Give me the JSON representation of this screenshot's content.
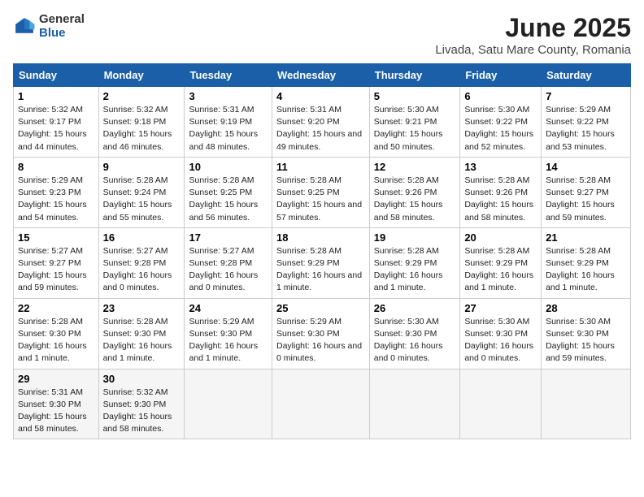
{
  "logo": {
    "general": "General",
    "blue": "Blue"
  },
  "title": "June 2025",
  "subtitle": "Livada, Satu Mare County, Romania",
  "headers": [
    "Sunday",
    "Monday",
    "Tuesday",
    "Wednesday",
    "Thursday",
    "Friday",
    "Saturday"
  ],
  "weeks": [
    [
      {
        "day": "1",
        "sunrise": "Sunrise: 5:32 AM",
        "sunset": "Sunset: 9:17 PM",
        "daylight": "Daylight: 15 hours and 44 minutes."
      },
      {
        "day": "2",
        "sunrise": "Sunrise: 5:32 AM",
        "sunset": "Sunset: 9:18 PM",
        "daylight": "Daylight: 15 hours and 46 minutes."
      },
      {
        "day": "3",
        "sunrise": "Sunrise: 5:31 AM",
        "sunset": "Sunset: 9:19 PM",
        "daylight": "Daylight: 15 hours and 48 minutes."
      },
      {
        "day": "4",
        "sunrise": "Sunrise: 5:31 AM",
        "sunset": "Sunset: 9:20 PM",
        "daylight": "Daylight: 15 hours and 49 minutes."
      },
      {
        "day": "5",
        "sunrise": "Sunrise: 5:30 AM",
        "sunset": "Sunset: 9:21 PM",
        "daylight": "Daylight: 15 hours and 50 minutes."
      },
      {
        "day": "6",
        "sunrise": "Sunrise: 5:30 AM",
        "sunset": "Sunset: 9:22 PM",
        "daylight": "Daylight: 15 hours and 52 minutes."
      },
      {
        "day": "7",
        "sunrise": "Sunrise: 5:29 AM",
        "sunset": "Sunset: 9:22 PM",
        "daylight": "Daylight: 15 hours and 53 minutes."
      }
    ],
    [
      {
        "day": "8",
        "sunrise": "Sunrise: 5:29 AM",
        "sunset": "Sunset: 9:23 PM",
        "daylight": "Daylight: 15 hours and 54 minutes."
      },
      {
        "day": "9",
        "sunrise": "Sunrise: 5:28 AM",
        "sunset": "Sunset: 9:24 PM",
        "daylight": "Daylight: 15 hours and 55 minutes."
      },
      {
        "day": "10",
        "sunrise": "Sunrise: 5:28 AM",
        "sunset": "Sunset: 9:25 PM",
        "daylight": "Daylight: 15 hours and 56 minutes."
      },
      {
        "day": "11",
        "sunrise": "Sunrise: 5:28 AM",
        "sunset": "Sunset: 9:25 PM",
        "daylight": "Daylight: 15 hours and 57 minutes."
      },
      {
        "day": "12",
        "sunrise": "Sunrise: 5:28 AM",
        "sunset": "Sunset: 9:26 PM",
        "daylight": "Daylight: 15 hours and 58 minutes."
      },
      {
        "day": "13",
        "sunrise": "Sunrise: 5:28 AM",
        "sunset": "Sunset: 9:26 PM",
        "daylight": "Daylight: 15 hours and 58 minutes."
      },
      {
        "day": "14",
        "sunrise": "Sunrise: 5:28 AM",
        "sunset": "Sunset: 9:27 PM",
        "daylight": "Daylight: 15 hours and 59 minutes."
      }
    ],
    [
      {
        "day": "15",
        "sunrise": "Sunrise: 5:27 AM",
        "sunset": "Sunset: 9:27 PM",
        "daylight": "Daylight: 15 hours and 59 minutes."
      },
      {
        "day": "16",
        "sunrise": "Sunrise: 5:27 AM",
        "sunset": "Sunset: 9:28 PM",
        "daylight": "Daylight: 16 hours and 0 minutes."
      },
      {
        "day": "17",
        "sunrise": "Sunrise: 5:27 AM",
        "sunset": "Sunset: 9:28 PM",
        "daylight": "Daylight: 16 hours and 0 minutes."
      },
      {
        "day": "18",
        "sunrise": "Sunrise: 5:28 AM",
        "sunset": "Sunset: 9:29 PM",
        "daylight": "Daylight: 16 hours and 1 minute."
      },
      {
        "day": "19",
        "sunrise": "Sunrise: 5:28 AM",
        "sunset": "Sunset: 9:29 PM",
        "daylight": "Daylight: 16 hours and 1 minute."
      },
      {
        "day": "20",
        "sunrise": "Sunrise: 5:28 AM",
        "sunset": "Sunset: 9:29 PM",
        "daylight": "Daylight: 16 hours and 1 minute."
      },
      {
        "day": "21",
        "sunrise": "Sunrise: 5:28 AM",
        "sunset": "Sunset: 9:29 PM",
        "daylight": "Daylight: 16 hours and 1 minute."
      }
    ],
    [
      {
        "day": "22",
        "sunrise": "Sunrise: 5:28 AM",
        "sunset": "Sunset: 9:30 PM",
        "daylight": "Daylight: 16 hours and 1 minute."
      },
      {
        "day": "23",
        "sunrise": "Sunrise: 5:28 AM",
        "sunset": "Sunset: 9:30 PM",
        "daylight": "Daylight: 16 hours and 1 minute."
      },
      {
        "day": "24",
        "sunrise": "Sunrise: 5:29 AM",
        "sunset": "Sunset: 9:30 PM",
        "daylight": "Daylight: 16 hours and 1 minute."
      },
      {
        "day": "25",
        "sunrise": "Sunrise: 5:29 AM",
        "sunset": "Sunset: 9:30 PM",
        "daylight": "Daylight: 16 hours and 0 minutes."
      },
      {
        "day": "26",
        "sunrise": "Sunrise: 5:30 AM",
        "sunset": "Sunset: 9:30 PM",
        "daylight": "Daylight: 16 hours and 0 minutes."
      },
      {
        "day": "27",
        "sunrise": "Sunrise: 5:30 AM",
        "sunset": "Sunset: 9:30 PM",
        "daylight": "Daylight: 16 hours and 0 minutes."
      },
      {
        "day": "28",
        "sunrise": "Sunrise: 5:30 AM",
        "sunset": "Sunset: 9:30 PM",
        "daylight": "Daylight: 15 hours and 59 minutes."
      }
    ],
    [
      {
        "day": "29",
        "sunrise": "Sunrise: 5:31 AM",
        "sunset": "Sunset: 9:30 PM",
        "daylight": "Daylight: 15 hours and 58 minutes."
      },
      {
        "day": "30",
        "sunrise": "Sunrise: 5:32 AM",
        "sunset": "Sunset: 9:30 PM",
        "daylight": "Daylight: 15 hours and 58 minutes."
      },
      null,
      null,
      null,
      null,
      null
    ]
  ]
}
